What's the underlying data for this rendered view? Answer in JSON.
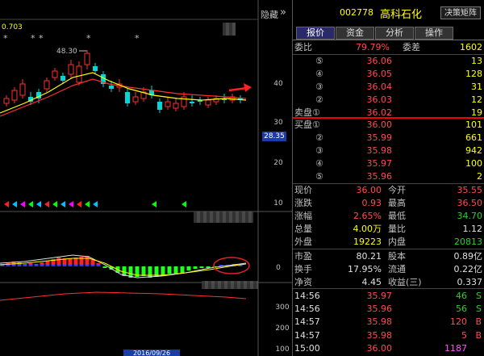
{
  "chart": {
    "hide_label": "隐藏",
    "collapse_icon": "»",
    "ma_label": "0.703",
    "peak_label": "48.30",
    "star_marks": [
      "*",
      "*",
      "*",
      "*",
      "*"
    ],
    "price_badge": "28.35",
    "price_axis": [
      "40",
      "30",
      "20",
      "10"
    ],
    "macd_axis": [
      "0"
    ],
    "vol_axis": [
      "300",
      "200",
      "100"
    ],
    "date_strip": "2016/09/26"
  },
  "quote": {
    "code": "002778",
    "name": "高科石化",
    "decision_btn": "决策矩阵",
    "tabs": [
      "报价",
      "资金",
      "分析",
      "操作"
    ],
    "weibi_label": "委比",
    "weibi_value": "79.79%",
    "weicha_label": "委差",
    "weicha_value": "1602",
    "sell_label": "卖盘",
    "buy_label": "买盘",
    "sell": [
      {
        "n": "⑤",
        "price": "36.06",
        "vol": "13"
      },
      {
        "n": "④",
        "price": "36.05",
        "vol": "128"
      },
      {
        "n": "③",
        "price": "36.04",
        "vol": "31"
      },
      {
        "n": "②",
        "price": "36.03",
        "vol": "12"
      },
      {
        "n": "①",
        "price": "36.02",
        "vol": "19"
      }
    ],
    "buy": [
      {
        "n": "①",
        "price": "36.00",
        "vol": "101"
      },
      {
        "n": "②",
        "price": "35.99",
        "vol": "661"
      },
      {
        "n": "③",
        "price": "35.98",
        "vol": "942"
      },
      {
        "n": "④",
        "price": "35.97",
        "vol": "100"
      },
      {
        "n": "⑤",
        "price": "35.96",
        "vol": "2"
      }
    ],
    "stats": [
      {
        "l1": "现价",
        "v1": "36.00",
        "c1": "red",
        "l2": "今开",
        "v2": "35.55",
        "c2": "red"
      },
      {
        "l1": "涨跌",
        "v1": "0.93",
        "c1": "red",
        "l2": "最高",
        "v2": "36.50",
        "c2": "red"
      },
      {
        "l1": "涨幅",
        "v1": "2.65%",
        "c1": "red",
        "l2": "最低",
        "v2": "34.70",
        "c2": "green"
      },
      {
        "l1": "总量",
        "v1": "4.00万",
        "c1": "yellow",
        "l2": "量比",
        "v2": "1.12",
        "c2": "white"
      },
      {
        "l1": "外盘",
        "v1": "19223",
        "c1": "yellow",
        "l2": "内盘",
        "v2": "20813",
        "c2": "green"
      }
    ],
    "stats2": [
      {
        "l1": "市盈",
        "v1": "80.21",
        "c1": "white",
        "l2": "股本",
        "v2": "0.89亿",
        "c2": "white"
      },
      {
        "l1": "换手",
        "v1": "17.95%",
        "c1": "white",
        "l2": "流通",
        "v2": "0.22亿",
        "c2": "white"
      },
      {
        "l1": "净资",
        "v1": "4.45",
        "c1": "white",
        "l2": "收益(三)",
        "v2": "0.337",
        "c2": "white"
      }
    ],
    "ticks": [
      {
        "time": "14:56",
        "price": "35.97",
        "vol": "46",
        "side": "S",
        "sc": "green"
      },
      {
        "time": "14:56",
        "price": "35.96",
        "vol": "56",
        "side": "S",
        "sc": "green"
      },
      {
        "time": "14:57",
        "price": "35.98",
        "vol": "120",
        "side": "B",
        "sc": "red"
      },
      {
        "time": "14:57",
        "price": "35.98",
        "vol": "5",
        "side": "B",
        "sc": "red"
      },
      {
        "time": "15:00",
        "price": "36.00",
        "vol": "1187",
        "side": "",
        "sc": "magenta"
      }
    ]
  },
  "colors": {
    "up": "#ff3030",
    "down": "#00d8d8",
    "ma5": "#ffff00",
    "ma10": "#ff3030",
    "macd_up": "#ff2020",
    "macd_down": "#22ff22"
  }
}
